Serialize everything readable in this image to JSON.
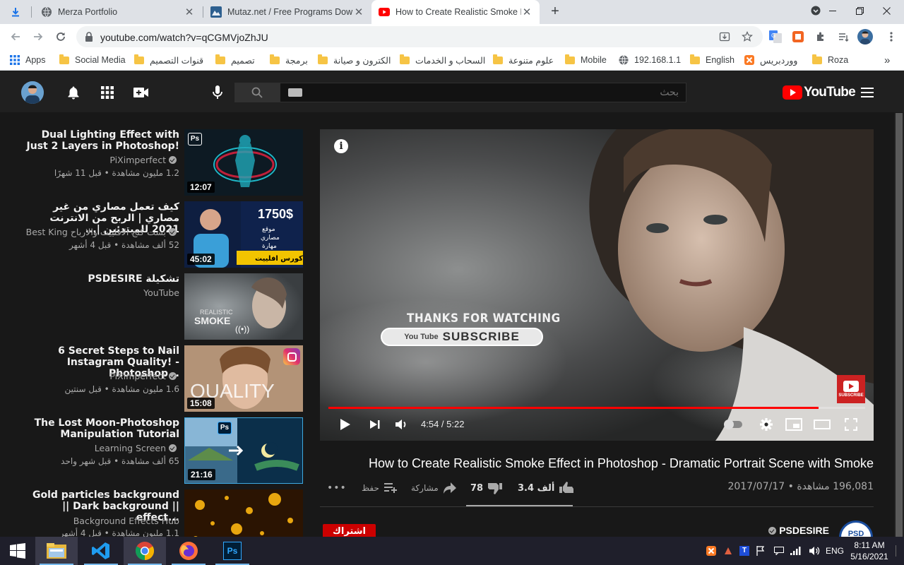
{
  "browser": {
    "tabs": [
      {
        "title": "Merza Portfolio",
        "active": false
      },
      {
        "title": "Mutaz.net / Free Programs Down",
        "active": false
      },
      {
        "title": "How to Create Realistic Smoke Ef",
        "active": true
      }
    ],
    "new_tab_label": "+",
    "url": "youtube.com/watch?v=qCGMVjoZhJU",
    "bookmarks": [
      {
        "label": "Apps",
        "type": "apps"
      },
      {
        "label": "Social Media",
        "type": "folder"
      },
      {
        "label": "قنوات التصميم",
        "type": "folder"
      },
      {
        "label": "تصميم",
        "type": "folder"
      },
      {
        "label": "برمجة",
        "type": "folder"
      },
      {
        "label": "الكترون و صيانة",
        "type": "folder"
      },
      {
        "label": "السحاب و الخدمات",
        "type": "folder"
      },
      {
        "label": "علوم متنوعة",
        "type": "folder"
      },
      {
        "label": "Mobile",
        "type": "folder"
      },
      {
        "label": "192.168.1.1",
        "type": "globe"
      },
      {
        "label": "English",
        "type": "folder"
      },
      {
        "label": "ووردبريس",
        "type": "xampp"
      },
      {
        "label": "Roza",
        "type": "folder"
      }
    ],
    "bookmarks_overflow": "»"
  },
  "youtube": {
    "search_placeholder": "بحث",
    "logo_text": "YouTube",
    "related": [
      {
        "title": "Dual Lighting Effect with Just 2 Layers in Photoshop!",
        "channel": "PiXimperfect",
        "meta": "1.2 مليون مشاهدة • قبل 11 شهرًا",
        "duration": "12:07",
        "thumb": "dual"
      },
      {
        "title": "كيف تعمل مصاري من غير مصاري | الربح من الانترنت 2021 للمبتدئين |...",
        "channel": "بست كنج الافلييت والارباح Best King",
        "meta": "52 ألف مشاهدة • قبل 4 أشهر",
        "duration": "45:02",
        "thumb": "money",
        "thumb_text": "1750$"
      },
      {
        "title": "تشكيلة PSDESIRE",
        "channel": "YouTube",
        "meta": "",
        "duration": "",
        "thumb": "smoke",
        "thumb_text": "REALISTIC SMOKE"
      },
      {
        "title": "6 Secret Steps to Nail Instagram Quality! - Photoshop...",
        "channel": "PiXimperfect",
        "meta": "1.6 مليون مشاهدة • قبل سنتين",
        "duration": "15:08",
        "thumb": "quality",
        "thumb_text": "QUALITY"
      },
      {
        "title": "The Lost Moon-Photoshop Manipulation Tutorial",
        "channel": "Learning Screen",
        "meta": "65 ألف مشاهدة • قبل شهر واحد",
        "duration": "21:16",
        "thumb": "moon"
      },
      {
        "title": "Gold particles background || Dark background || effect...",
        "channel": "Background Effects Hub",
        "meta": "1.1 مليون مشاهدة • قبل 4 أشهر",
        "duration": "",
        "thumb": "gold"
      }
    ],
    "player": {
      "overlay_line1": "THANKS FOR WATCHING",
      "overlay_button": "SUBSCRIBE",
      "overlay_brand": "You Tube",
      "watermark_text": "SUBSCRIBE",
      "time_current": "4:54",
      "time_total": "5:22",
      "time_separator": " / ",
      "progress": 0.913
    },
    "video": {
      "title": "How to Create Realistic Smoke Effect in Photoshop - Dramatic Portrait Scene with Smoke",
      "views": "196,081 مشاهدة",
      "date": "2017/07/17",
      "likes": "3.4 ألف",
      "dislikes": "78",
      "share_label": "مشاركة",
      "save_label": "حفظ",
      "more_label": "•••"
    },
    "channel": {
      "name": "PSDESIRE",
      "subscribe_label": "اشتراك",
      "avatar_text": "PSD"
    }
  },
  "taskbar": {
    "lang": "ENG",
    "time": "8:11 AM",
    "date": "5/16/2021"
  },
  "colors": {
    "yt_red": "#ff0000",
    "yt_bg": "#181818",
    "yt_head": "#202020",
    "taskbar": "#1f1f2b"
  }
}
